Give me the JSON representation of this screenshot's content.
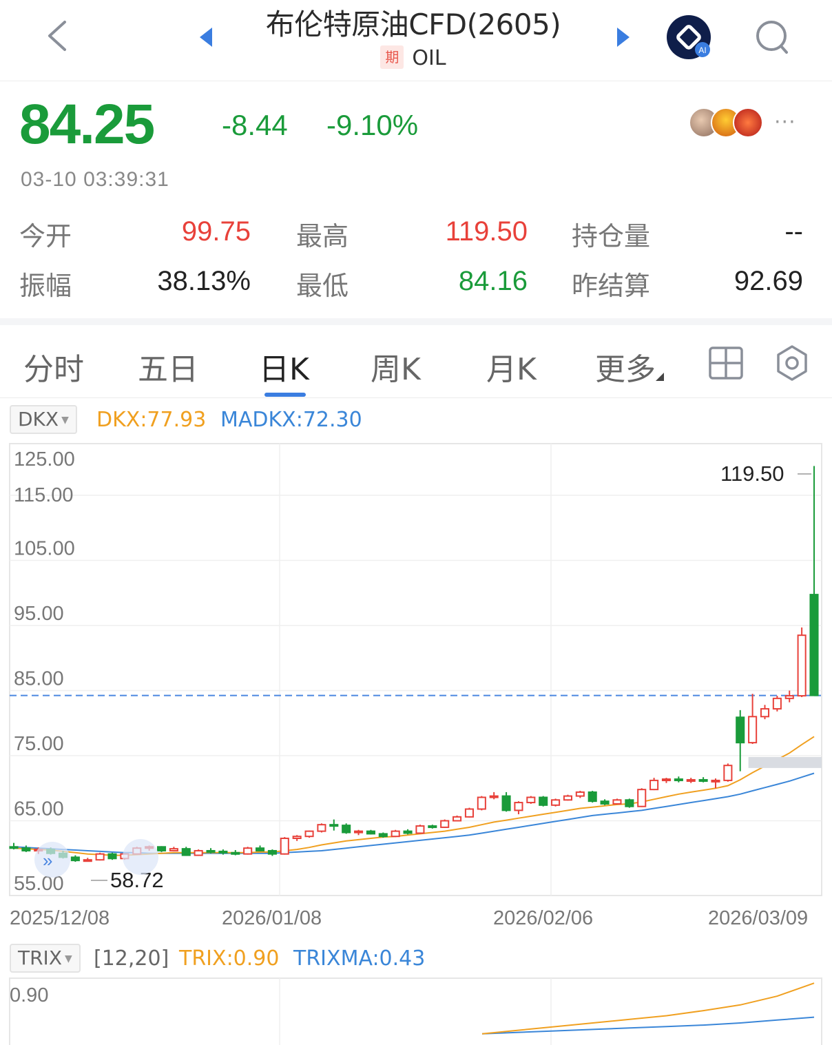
{
  "header": {
    "title": "布伦特原油CFD(2605)",
    "badge": "期",
    "code": "OIL"
  },
  "quote": {
    "price": "84.25",
    "change": "-8.44",
    "change_pct": "-9.10%",
    "more": "···",
    "timestamp": "03-10 03:39:31"
  },
  "stats": {
    "open_label": "今开",
    "open_value": "99.75",
    "high_label": "最高",
    "high_value": "119.50",
    "oi_label": "持仓量",
    "oi_value": "--",
    "amp_label": "振幅",
    "amp_value": "38.13%",
    "low_label": "最低",
    "low_value": "84.16",
    "settle_label": "昨结算",
    "settle_value": "92.69"
  },
  "tabs": {
    "intraday": "分时",
    "five_day": "五日",
    "daily_k": "日K",
    "weekly_k": "周K",
    "monthly_k": "月K",
    "more": "更多"
  },
  "indicator_main": {
    "name": "DKX",
    "dkx": "DKX:77.93",
    "madkx": "MADKX:72.30"
  },
  "indicator_sub": {
    "name": "TRIX",
    "params": "[12,20]",
    "trix": "TRIX:0.90",
    "trixma": "TRIXMA:0.43"
  },
  "colors": {
    "up": "#e8413a",
    "down": "#1a9b3a",
    "accent": "#3a7de0",
    "dkx_line": "#f0a020",
    "madkx_line": "#3a86d8"
  },
  "chart_data": {
    "type": "candlestick",
    "y_ticks": [
      "125.00",
      "115.00",
      "105.00",
      "95.00",
      "85.00",
      "75.00",
      "65.00",
      "55.00"
    ],
    "y_range": [
      55,
      125
    ],
    "x_ticks": [
      "2025/12/08",
      "2026/01/08",
      "2026/02/06",
      "2026/03/09"
    ],
    "max_label": "119.50",
    "min_label": "58.72",
    "current_price": 84.25,
    "ohlc": [
      [
        61.0,
        61.6,
        60.6,
        60.8
      ],
      [
        60.8,
        61.2,
        60.2,
        60.4
      ],
      [
        60.4,
        60.9,
        59.9,
        60.6
      ],
      [
        60.6,
        60.9,
        59.8,
        60.0
      ],
      [
        60.0,
        60.4,
        59.2,
        59.4
      ],
      [
        59.4,
        59.7,
        58.7,
        58.9
      ],
      [
        58.9,
        59.3,
        58.72,
        59.0
      ],
      [
        59.0,
        60.1,
        58.9,
        59.9
      ],
      [
        59.9,
        60.1,
        59.0,
        59.2
      ],
      [
        59.2,
        60.0,
        59.0,
        59.9
      ],
      [
        59.9,
        61.0,
        59.8,
        60.8
      ],
      [
        60.8,
        61.2,
        60.4,
        61.0
      ],
      [
        61.0,
        61.1,
        60.2,
        60.4
      ],
      [
        60.4,
        61.0,
        60.3,
        60.7
      ],
      [
        60.7,
        61.0,
        59.6,
        59.7
      ],
      [
        59.7,
        60.6,
        59.6,
        60.4
      ],
      [
        60.4,
        60.8,
        60.0,
        60.3
      ],
      [
        60.3,
        60.6,
        59.8,
        60.1
      ],
      [
        60.1,
        60.5,
        59.7,
        59.9
      ],
      [
        59.9,
        61.0,
        59.8,
        60.8
      ],
      [
        60.8,
        61.2,
        60.3,
        60.4
      ],
      [
        60.4,
        60.6,
        59.6,
        59.9
      ],
      [
        59.9,
        62.5,
        59.8,
        62.3
      ],
      [
        62.3,
        62.8,
        61.9,
        62.6
      ],
      [
        62.6,
        63.5,
        62.4,
        63.4
      ],
      [
        63.4,
        64.6,
        63.2,
        64.4
      ],
      [
        64.4,
        65.2,
        63.5,
        64.3
      ],
      [
        64.3,
        64.6,
        63.0,
        63.2
      ],
      [
        63.2,
        63.6,
        62.8,
        63.4
      ],
      [
        63.4,
        63.6,
        62.9,
        63.0
      ],
      [
        63.0,
        63.2,
        62.4,
        62.6
      ],
      [
        62.6,
        63.6,
        62.5,
        63.4
      ],
      [
        63.4,
        63.7,
        62.9,
        63.1
      ],
      [
        63.1,
        64.4,
        63.0,
        64.2
      ],
      [
        64.2,
        64.4,
        63.8,
        64.0
      ],
      [
        64.0,
        65.2,
        63.9,
        65.0
      ],
      [
        65.0,
        65.8,
        64.9,
        65.6
      ],
      [
        65.6,
        67.0,
        65.5,
        66.8
      ],
      [
        66.8,
        68.8,
        66.6,
        68.6
      ],
      [
        68.6,
        69.4,
        68.3,
        68.8
      ],
      [
        68.8,
        69.4,
        66.4,
        66.6
      ],
      [
        66.6,
        68.0,
        66.0,
        67.8
      ],
      [
        67.8,
        68.8,
        67.6,
        68.6
      ],
      [
        68.6,
        68.8,
        67.2,
        67.4
      ],
      [
        67.4,
        68.4,
        67.2,
        68.2
      ],
      [
        68.2,
        69.0,
        68.1,
        68.8
      ],
      [
        68.8,
        69.6,
        68.5,
        69.4
      ],
      [
        69.4,
        69.6,
        67.8,
        68.0
      ],
      [
        68.0,
        68.3,
        67.4,
        67.6
      ],
      [
        67.6,
        68.4,
        67.5,
        68.2
      ],
      [
        68.2,
        68.4,
        67.0,
        67.2
      ],
      [
        67.2,
        70.0,
        67.1,
        69.8
      ],
      [
        69.8,
        71.6,
        69.7,
        71.2
      ],
      [
        71.2,
        71.6,
        70.8,
        71.4
      ],
      [
        71.4,
        71.8,
        70.9,
        71.2
      ],
      [
        71.2,
        71.6,
        70.8,
        71.3
      ],
      [
        71.3,
        71.7,
        70.9,
        71.1
      ],
      [
        71.1,
        71.5,
        70.0,
        71.2
      ],
      [
        71.2,
        73.8,
        71.0,
        73.5
      ],
      [
        80.9,
        82.0,
        72.6,
        77.0
      ],
      [
        77.0,
        84.5,
        76.8,
        81.0
      ],
      [
        81.0,
        82.8,
        80.6,
        82.2
      ],
      [
        82.2,
        84.2,
        81.8,
        83.8
      ],
      [
        83.8,
        85.0,
        83.2,
        84.2
      ],
      [
        84.2,
        94.7,
        84.0,
        93.5
      ],
      [
        99.75,
        119.5,
        84.16,
        84.25
      ]
    ],
    "dkx": [
      60.8,
      60.7,
      60.6,
      60.5,
      60.3,
      60.1,
      59.9,
      59.8,
      59.7,
      59.7,
      59.8,
      59.9,
      60.0,
      60.1,
      60.1,
      60.1,
      60.1,
      60.1,
      60.1,
      60.1,
      60.2,
      60.2,
      60.4,
      60.6,
      60.9,
      61.3,
      61.6,
      61.9,
      62.1,
      62.3,
      62.5,
      62.6,
      62.8,
      63.0,
      63.2,
      63.4,
      63.7,
      64.0,
      64.4,
      64.8,
      65.1,
      65.4,
      65.7,
      66.0,
      66.3,
      66.6,
      66.9,
      67.1,
      67.3,
      67.5,
      67.6,
      67.9,
      68.3,
      68.7,
      69.1,
      69.4,
      69.7,
      70.0,
      70.4,
      71.3,
      72.4,
      73.4,
      74.4,
      75.4,
      76.7,
      77.93
    ],
    "madkx": [
      61.0,
      60.9,
      60.8,
      60.7,
      60.6,
      60.5,
      60.4,
      60.3,
      60.2,
      60.1,
      60.1,
      60.0,
      60.0,
      60.0,
      60.0,
      60.0,
      60.0,
      60.0,
      60.0,
      60.0,
      60.0,
      60.0,
      60.1,
      60.2,
      60.3,
      60.4,
      60.6,
      60.8,
      61.0,
      61.2,
      61.4,
      61.6,
      61.8,
      62.0,
      62.2,
      62.4,
      62.6,
      62.8,
      63.1,
      63.4,
      63.7,
      64.0,
      64.3,
      64.6,
      64.9,
      65.2,
      65.5,
      65.8,
      66.0,
      66.2,
      66.4,
      66.6,
      66.9,
      67.2,
      67.5,
      67.8,
      68.1,
      68.4,
      68.7,
      69.1,
      69.6,
      70.1,
      70.6,
      71.1,
      71.7,
      72.3
    ],
    "trix": {
      "y_ticks": [
        "0.90"
      ],
      "trix": [
        0.2,
        0.25,
        0.3,
        0.35,
        0.4,
        0.45,
        0.52,
        0.6,
        0.72,
        0.9
      ],
      "trixma": [
        0.2,
        0.22,
        0.24,
        0.26,
        0.28,
        0.3,
        0.32,
        0.35,
        0.39,
        0.43
      ]
    }
  }
}
